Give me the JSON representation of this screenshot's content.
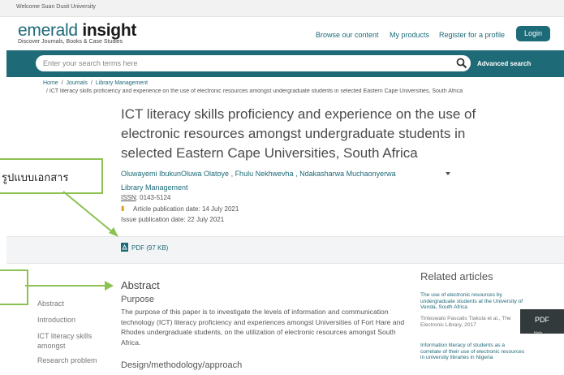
{
  "welcome": "Welcome Suan Dusit University",
  "brand": {
    "part1": "emerald ",
    "part2": "insight",
    "tagline": "Discover Journals, Books & Case Studies"
  },
  "nav": {
    "browse": "Browse our content",
    "products": "My products",
    "register": "Register for a profile",
    "login": "Login"
  },
  "search": {
    "placeholder": "Enter your search terms here",
    "advanced": "Advanced search"
  },
  "breadcrumb": {
    "home": "Home",
    "journals": "Journals",
    "journal": "Library Management",
    "sep": "/",
    "current": "/  ICT literacy skills proficiency and experience on the use of electronic resources amongst undergraduate students in selected Eastern Cape Universities, South Africa"
  },
  "article": {
    "title": "ICT literacy skills proficiency and experience on the use of electronic resources amongst undergraduate students in selected Eastern Cape Universities, South Africa",
    "authors": "Oluwayemi IbukunOluwa Olatoye , Fhulu Nekhwevha , Ndakasharwa Muchaonyerwa",
    "journal": "Library Management",
    "issn_label": "ISSN",
    "issn_value": ": 0143-5124",
    "pub_date": "Article publication date: 14 July 2021",
    "issue_date": "Issue publication date: 22 July 2021",
    "pdf": "PDF (97 KB)"
  },
  "annotation": {
    "label": "รูปแบบเอกสาร"
  },
  "left_nav": [
    "Abstract",
    "Introduction",
    "ICT literacy skills",
    "amongst",
    "Research problem"
  ],
  "abstract": {
    "heading": "Abstract",
    "purpose_heading": "Purpose",
    "purpose_text": "The purpose of this paper is to investigate the levels of information and communication technology (ICT) literacy proficiency and experiences amongst Universities of Fort Hare and Rhodes undergraduate students, on the utilization of electronic resources amongst South Africa.",
    "design_heading": "Design/methodology/approach"
  },
  "related": {
    "heading": "Related articles",
    "item1_title": "The use of electronic resources by undergraduate students at the University of Venda, South Africa",
    "item1_meta": "Tinteswalo Pascalis Tlakula et al., The Electronic Library, 2017",
    "item2_title": "Information literacy of students as a correlate of their use of electronic resources in university libraries in Nigeria"
  },
  "floating": {
    "pdf": "PDF",
    "help": "Help"
  },
  "colors": {
    "brand_teal": "#1d6a78",
    "annotation_green": "#8dc152",
    "login_bg": "#1d6a78"
  }
}
